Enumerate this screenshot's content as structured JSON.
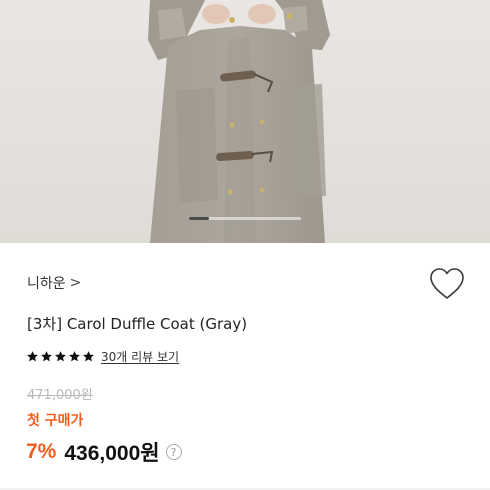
{
  "product_gallery": {
    "image_alt": "",
    "slide_progress": 0.18
  },
  "brand": {
    "name": "니하운",
    "chevron": ">"
  },
  "wishlist": {
    "icon": "heart-outline-icon",
    "label": ""
  },
  "product": {
    "title": "[3차] Carol Duffle Coat (Gray)"
  },
  "rating": {
    "stars": 5,
    "star_color": "#111111",
    "review_link": "30개 리뷰 보기"
  },
  "pricing": {
    "original_price": "471,000원",
    "first_purchase_label": "첫 구매가",
    "discount": "7%",
    "price": "436,000원",
    "help_icon": "?",
    "accent_color": "#f25c1f"
  }
}
